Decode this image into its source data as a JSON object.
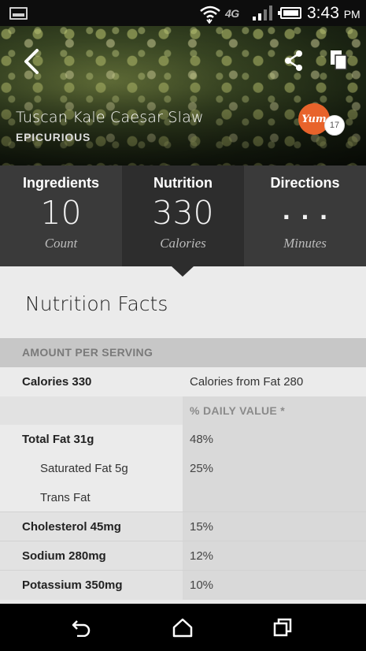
{
  "status_bar": {
    "network": "4G",
    "time": "3:43",
    "ampm": "PM",
    "icons": [
      "gallery-icon",
      "wifi-icon",
      "signal-icon",
      "battery-icon"
    ]
  },
  "header": {
    "recipe_title": "Tuscan Kale Caesar Slaw",
    "source": "EPICURIOUS",
    "yum_label": "Yum",
    "yum_count": "17",
    "icons": [
      "back-icon",
      "share-icon",
      "copy-icon"
    ],
    "accent_color": "#e8632b"
  },
  "stats": [
    {
      "label": "Ingredients",
      "value": "10",
      "unit": "Count"
    },
    {
      "label": "Nutrition",
      "value": "330",
      "unit": "Calories"
    },
    {
      "label": "Directions",
      "value": "...",
      "unit": "Minutes"
    }
  ],
  "nutrition": {
    "title": "Nutrition Facts",
    "amount_header": "AMOUNT PER SERVING",
    "calories_row": {
      "left": "Calories 330",
      "right": "Calories from Fat 280"
    },
    "daily_value_header": "% DAILY VALUE *",
    "rows": [
      {
        "name": "Total Fat 31g",
        "value": "48%"
      },
      {
        "name": "Saturated Fat 5g",
        "value": "25%"
      },
      {
        "name": "Trans Fat",
        "value": ""
      },
      {
        "name": "Cholesterol 45mg",
        "value": "15%"
      },
      {
        "name": "Sodium 280mg",
        "value": "12%"
      },
      {
        "name": "Potassium 350mg",
        "value": "10%"
      }
    ]
  },
  "nav_bar": {
    "icons": [
      "nav-back-icon",
      "home-icon",
      "recent-apps-icon"
    ]
  }
}
